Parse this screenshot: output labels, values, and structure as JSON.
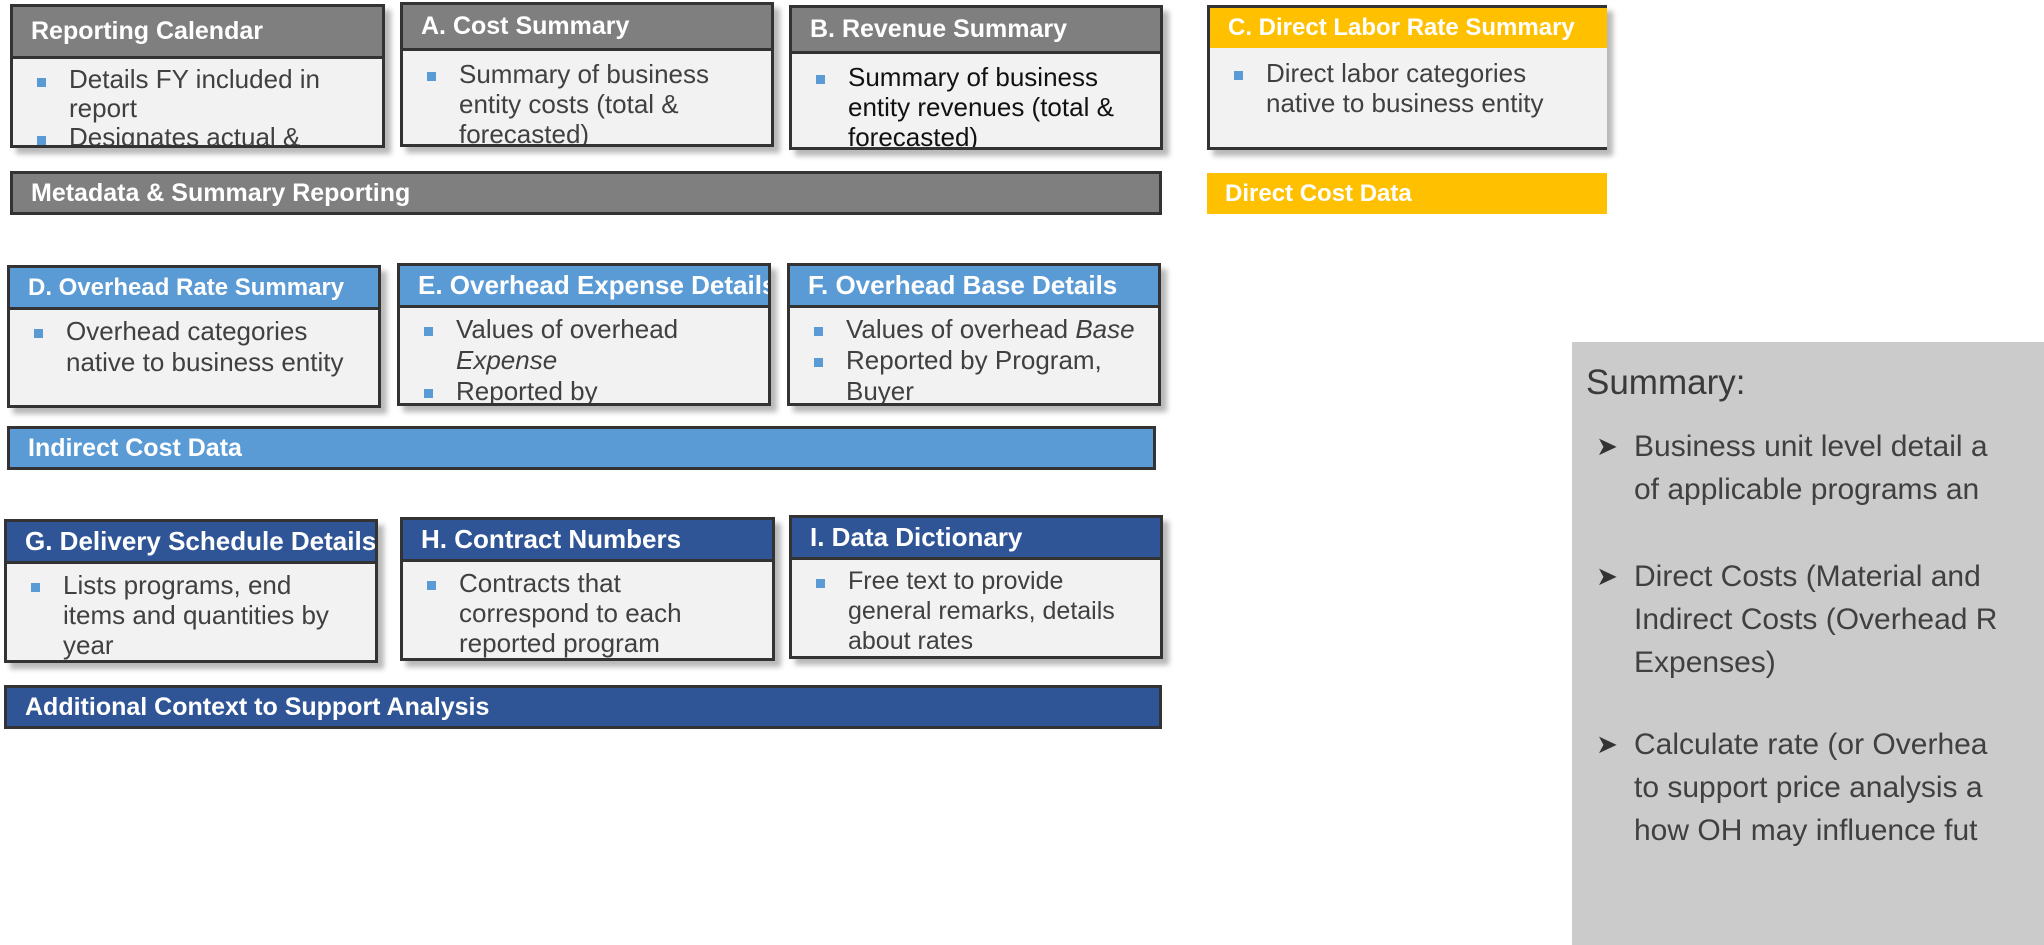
{
  "cards": {
    "reporting_calendar": {
      "title": "Reporting Calendar",
      "bullets": [
        "Details FY included in report",
        "Designates actual & forecast"
      ]
    },
    "cost_summary": {
      "title": "A. Cost Summary",
      "bullets": [
        "Summary of business entity costs (total & forecasted)"
      ]
    },
    "revenue_summary": {
      "title": "B. Revenue Summary",
      "bullets": [
        "Summary of business entity revenues (total & forecasted)"
      ]
    },
    "labor_rate_summary": {
      "title": "C. Direct Labor Rate Summary",
      "bullets": [
        "Direct labor categories native to business entity"
      ]
    },
    "overhead_rate_summary": {
      "title": "D. Overhead Rate Summary",
      "bullets": [
        "Overhead categories native to business entity"
      ]
    },
    "overhead_expense_details": {
      "title": "E. Overhead Expense Details",
      "bullet1_prefix": "Values of overhead ",
      "bullet1_em": "Expense",
      "bullet2": "Reported by subcomponent"
    },
    "overhead_base_details": {
      "title": "F. Overhead Base Details",
      "bullet1_prefix": "Values of overhead ",
      "bullet1_em": "Base",
      "bullet2": "Reported by Program, Buyer"
    },
    "delivery_schedule_details": {
      "title": "G. Delivery Schedule Details",
      "bullets": [
        "Lists programs, end items and quantities by year"
      ]
    },
    "contract_numbers": {
      "title": "H. Contract Numbers",
      "bullets": [
        "Contracts that correspond to each reported program"
      ]
    },
    "data_dictionary": {
      "title": "I. Data Dictionary",
      "bullets": [
        "Free text to provide general remarks, details about rates"
      ]
    }
  },
  "bars": {
    "metadata": "Metadata & Summary Reporting",
    "direct_cost": "Direct Cost Data",
    "indirect_cost": "Indirect Cost Data",
    "additional_context": "Additional Context to Support Analysis"
  },
  "summary": {
    "title": "Summary:",
    "items": [
      [
        "Business unit level detail a",
        "of applicable programs an"
      ],
      [
        "Direct Costs (Material and",
        "Indirect Costs (Overhead R",
        "Expenses)"
      ],
      [
        "Calculate rate (or Overhea",
        "to support price analysis a",
        "how OH may influence fut"
      ]
    ],
    "icon": "arrow-bullet-icon"
  },
  "colors": {
    "gray_header": "#7f7f7f",
    "gold_header": "#ffc000",
    "light_blue_header": "#5b9bd5",
    "dark_blue_header": "#2f5597",
    "card_body": "#f2f2f2",
    "summary_panel": "#cbcbcb"
  }
}
